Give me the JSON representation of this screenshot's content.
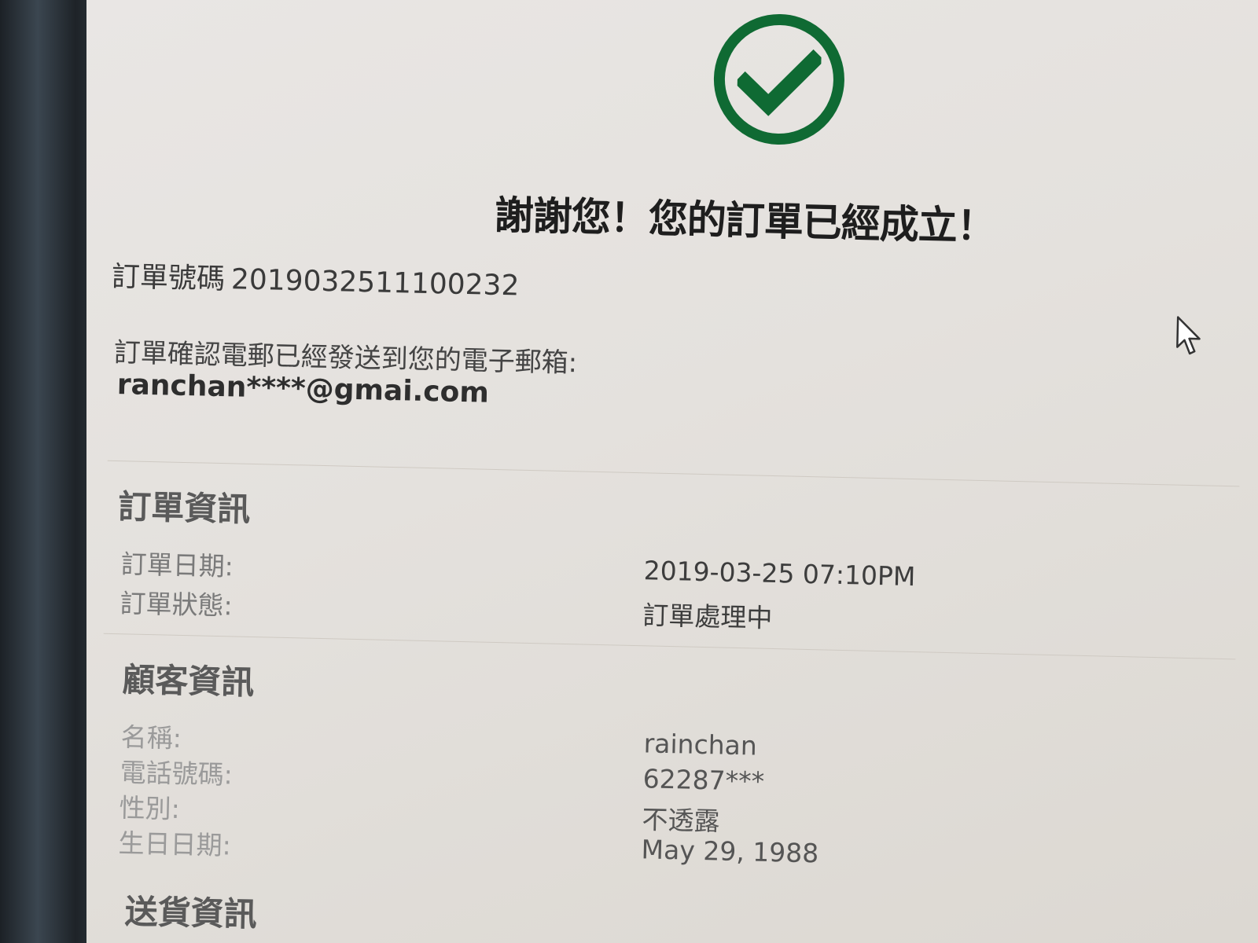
{
  "page": {
    "headline": "謝謝您！您的訂單已經成立！",
    "order_number_label": "訂單號碼",
    "order_number": "2019032511100232",
    "email_note": "訂單確認電郵已經發送到您的電子郵箱:",
    "email": "ranchan****@gmai.com"
  },
  "order_info": {
    "title": "訂單資訊",
    "rows": [
      {
        "label": "訂單日期:",
        "value": "2019-03-25 07:10PM"
      },
      {
        "label": "訂單狀態:",
        "value": "訂單處理中"
      }
    ]
  },
  "customer_info": {
    "title": "顧客資訊",
    "rows": [
      {
        "label": "名稱:",
        "value": "rainchan"
      },
      {
        "label": "電話號碼:",
        "value": "62287***"
      },
      {
        "label": "性別:",
        "value": "不透露"
      },
      {
        "label": "生日日期:",
        "value": "May 29, 1988"
      }
    ]
  },
  "delivery_info": {
    "title": "送貨資訊"
  },
  "icons": {
    "success": "check-circle-icon",
    "cursor": "mouse-pointer-icon"
  },
  "colors": {
    "success_green": "#0f6a33"
  }
}
